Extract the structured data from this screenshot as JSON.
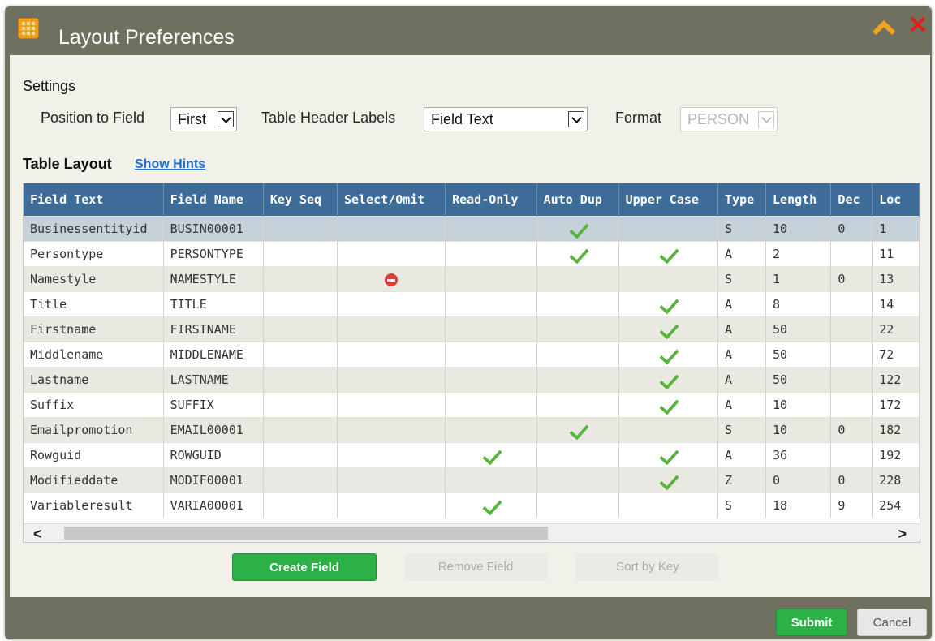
{
  "window": {
    "title": "Layout Preferences"
  },
  "settings": {
    "heading": "Settings",
    "position_label": "Position to Field",
    "position_value": "First",
    "header_labels_label": "Table Header Labels",
    "header_labels_value": "Field Text",
    "format_label": "Format",
    "format_value": "PERSON"
  },
  "table_layout": {
    "heading": "Table Layout",
    "hints_link": "Show Hints",
    "columns": [
      "Field Text",
      "Field Name",
      "Key Seq",
      "Select/Omit",
      "Read-Only",
      "Auto Dup",
      "Upper Case",
      "Type",
      "Length",
      "Dec",
      "Loc"
    ],
    "rows": [
      {
        "field_text": "Businessentityid",
        "field_name": "BUSIN00001",
        "key_seq": "",
        "select_omit": "",
        "read_only": false,
        "auto_dup": true,
        "upper_case": false,
        "type": "S",
        "length": "10",
        "dec": "0",
        "loc": "1"
      },
      {
        "field_text": "Persontype",
        "field_name": "PERSONTYPE",
        "key_seq": "",
        "select_omit": "",
        "read_only": false,
        "auto_dup": true,
        "upper_case": true,
        "type": "A",
        "length": "2",
        "dec": "",
        "loc": "11"
      },
      {
        "field_text": "Namestyle",
        "field_name": "NAMESTYLE",
        "key_seq": "",
        "select_omit": "omit",
        "read_only": false,
        "auto_dup": false,
        "upper_case": false,
        "type": "S",
        "length": "1",
        "dec": "0",
        "loc": "13"
      },
      {
        "field_text": "Title",
        "field_name": "TITLE",
        "key_seq": "",
        "select_omit": "",
        "read_only": false,
        "auto_dup": false,
        "upper_case": true,
        "type": "A",
        "length": "8",
        "dec": "",
        "loc": "14"
      },
      {
        "field_text": "Firstname",
        "field_name": "FIRSTNAME",
        "key_seq": "",
        "select_omit": "",
        "read_only": false,
        "auto_dup": false,
        "upper_case": true,
        "type": "A",
        "length": "50",
        "dec": "",
        "loc": "22"
      },
      {
        "field_text": "Middlename",
        "field_name": "MIDDLENAME",
        "key_seq": "",
        "select_omit": "",
        "read_only": false,
        "auto_dup": false,
        "upper_case": true,
        "type": "A",
        "length": "50",
        "dec": "",
        "loc": "72"
      },
      {
        "field_text": "Lastname",
        "field_name": "LASTNAME",
        "key_seq": "",
        "select_omit": "",
        "read_only": false,
        "auto_dup": false,
        "upper_case": true,
        "type": "A",
        "length": "50",
        "dec": "",
        "loc": "122"
      },
      {
        "field_text": "Suffix",
        "field_name": "SUFFIX",
        "key_seq": "",
        "select_omit": "",
        "read_only": false,
        "auto_dup": false,
        "upper_case": true,
        "type": "A",
        "length": "10",
        "dec": "",
        "loc": "172"
      },
      {
        "field_text": "Emailpromotion",
        "field_name": "EMAIL00001",
        "key_seq": "",
        "select_omit": "",
        "read_only": false,
        "auto_dup": true,
        "upper_case": false,
        "type": "S",
        "length": "10",
        "dec": "0",
        "loc": "182"
      },
      {
        "field_text": "Rowguid",
        "field_name": "ROWGUID",
        "key_seq": "",
        "select_omit": "",
        "read_only": true,
        "auto_dup": false,
        "upper_case": true,
        "type": "A",
        "length": "36",
        "dec": "",
        "loc": "192"
      },
      {
        "field_text": "Modifieddate",
        "field_name": "MODIF00001",
        "key_seq": "",
        "select_omit": "",
        "read_only": false,
        "auto_dup": false,
        "upper_case": true,
        "type": "Z",
        "length": "0",
        "dec": "0",
        "loc": "228"
      },
      {
        "field_text": "Variableresult",
        "field_name": "VARIA00001",
        "key_seq": "",
        "select_omit": "",
        "read_only": true,
        "auto_dup": false,
        "upper_case": false,
        "type": "S",
        "length": "18",
        "dec": "9",
        "loc": "254"
      }
    ]
  },
  "buttons": {
    "create_field": "Create Field",
    "remove_field": "Remove Field",
    "sort_by_key": "Sort by Key",
    "submit": "Submit",
    "cancel": "Cancel"
  },
  "icons": {
    "app": "grid-icon",
    "collapse": "chevron-up-icon",
    "close": "close-icon",
    "check": "checkmark-icon",
    "omit": "omit-icon"
  },
  "colors": {
    "header": "#3e6c98",
    "accent_green": "#2cb146",
    "window_frame": "#707060",
    "close_red": "#e0201a",
    "collapse_orange": "#f1a21e"
  }
}
